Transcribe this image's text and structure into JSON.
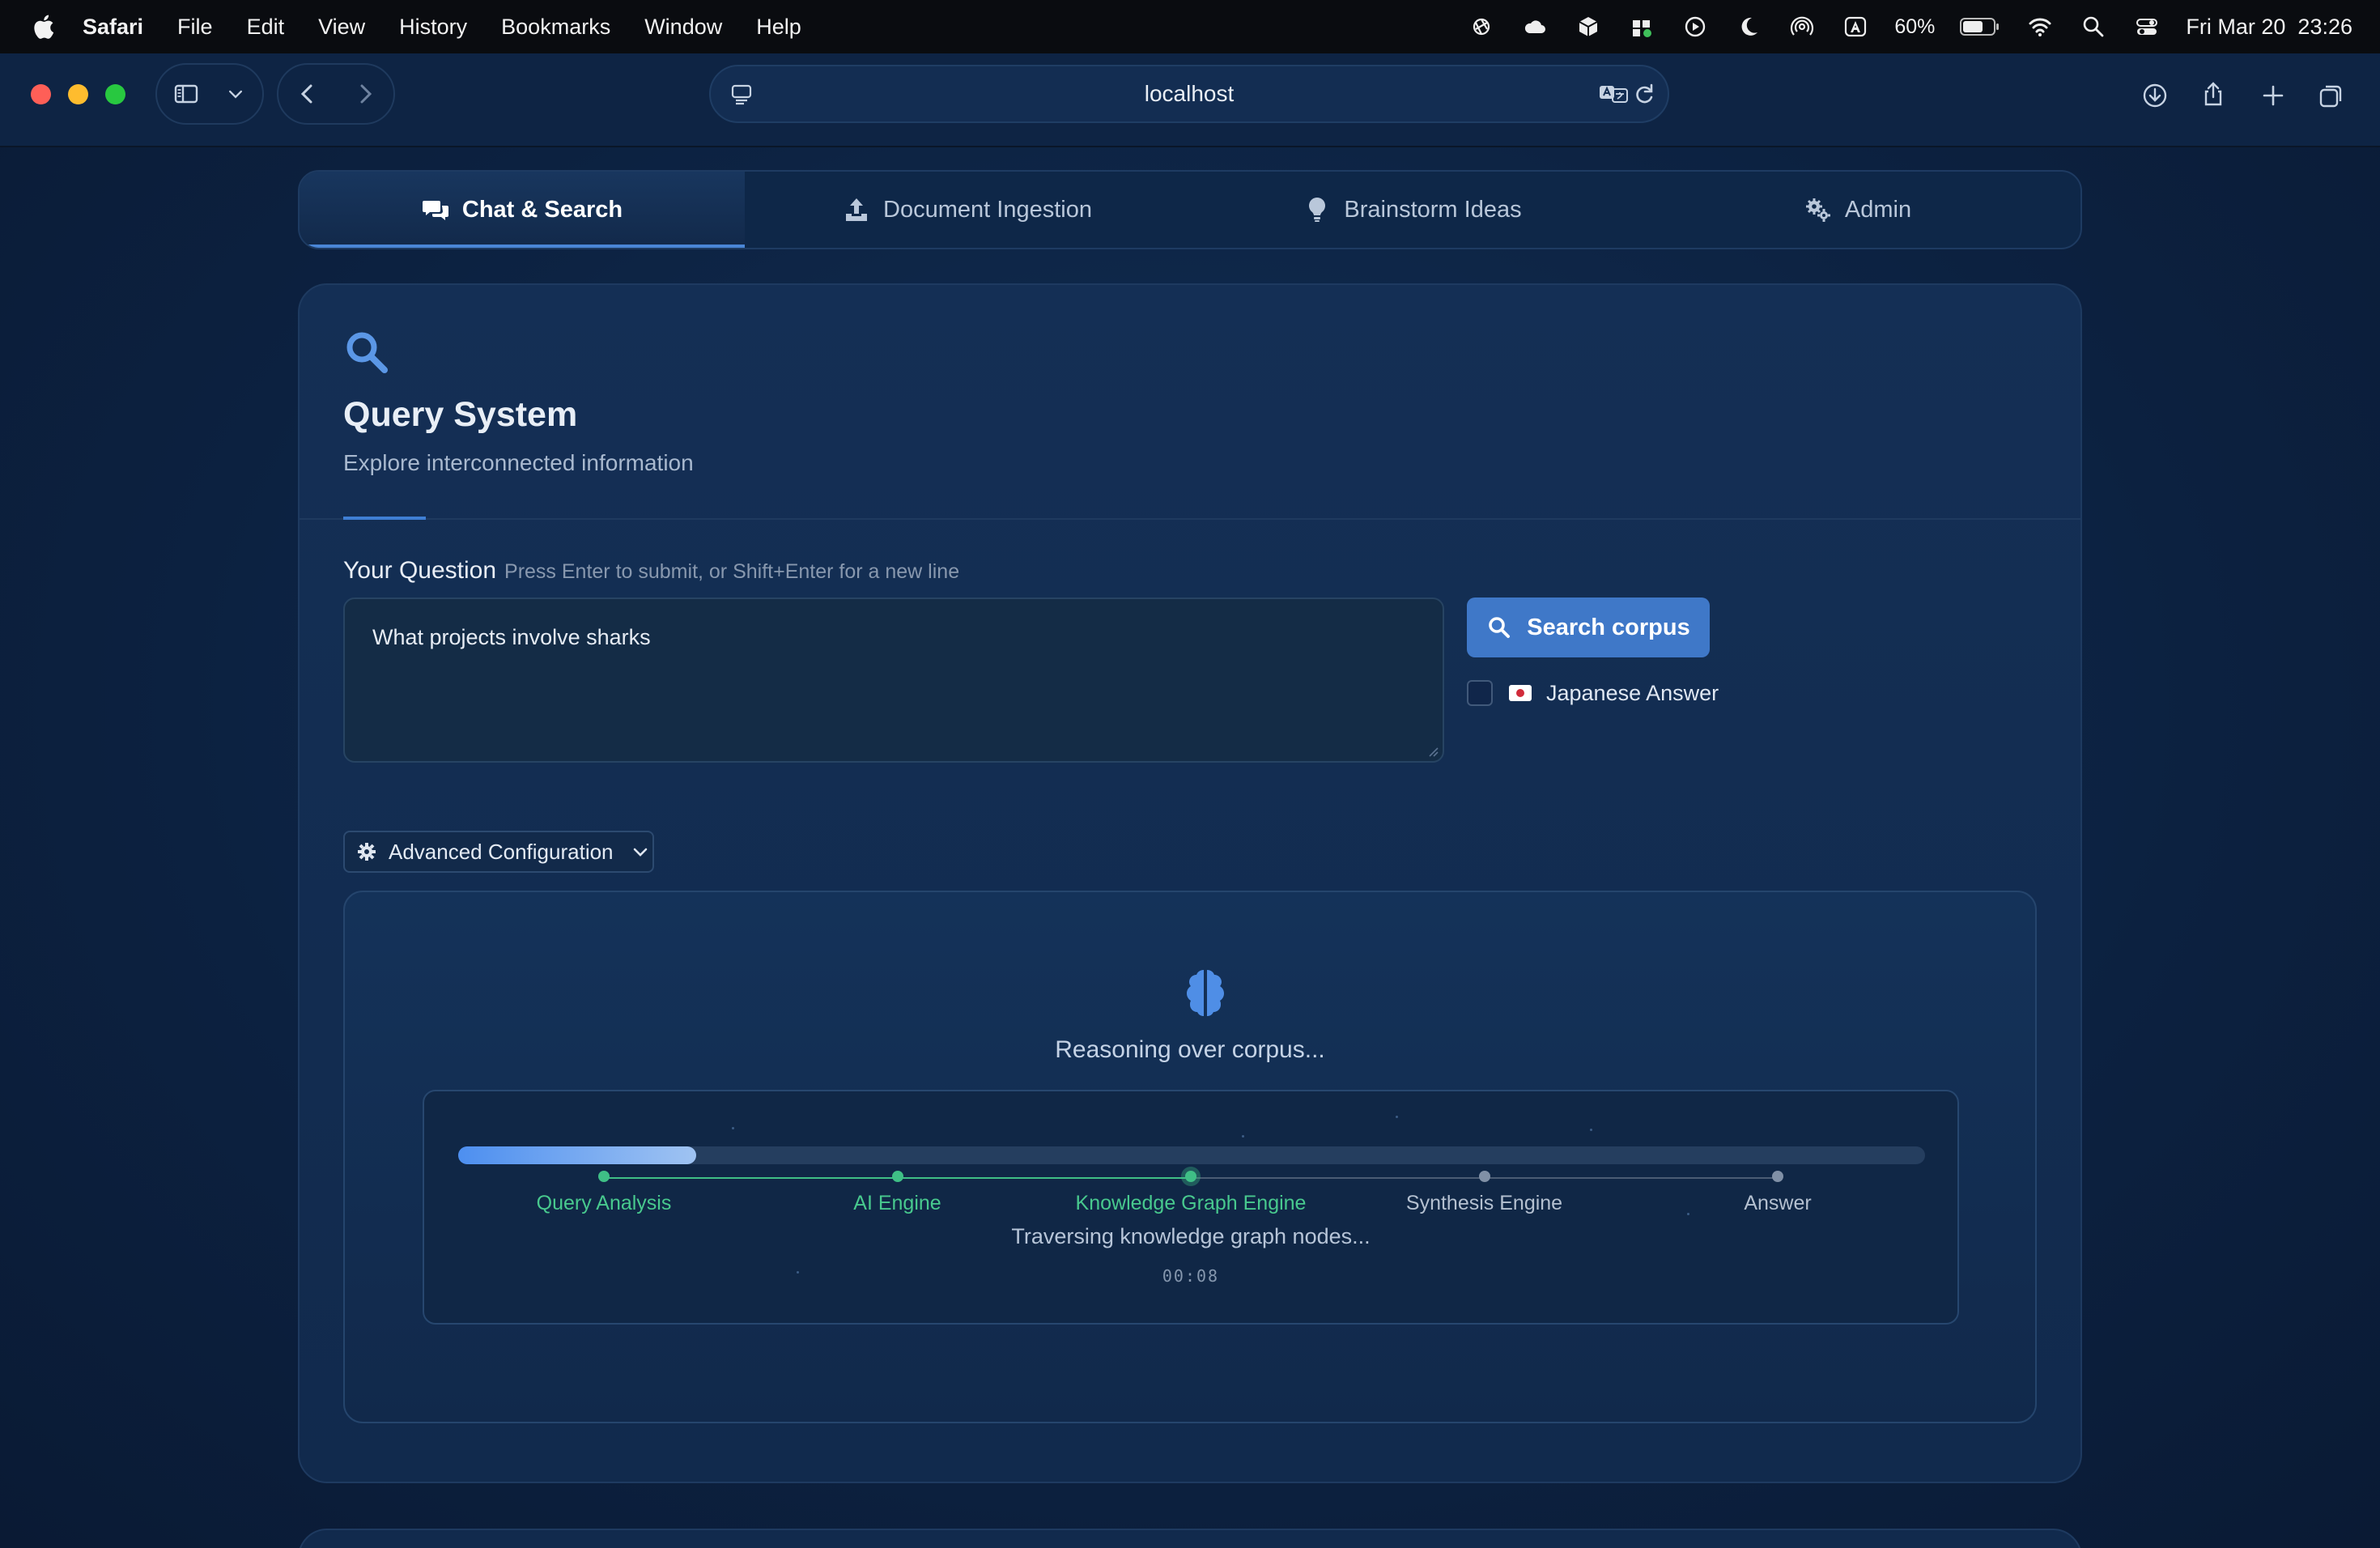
{
  "menubar": {
    "app": "Safari",
    "items": [
      "File",
      "Edit",
      "View",
      "History",
      "Bookmarks",
      "Window",
      "Help"
    ],
    "battery": "60%",
    "clock": "Fri Mar 20  23:26",
    "status_icons": [
      "openai-icon",
      "cloud-icon",
      "box-icon",
      "gift-icon",
      "play-icon",
      "moon-icon",
      "airdrop-icon",
      "keyboard-a-icon"
    ]
  },
  "browser": {
    "url": "localhost"
  },
  "tabs": [
    {
      "label": "Chat & Search",
      "icon": "comments-icon",
      "active": true
    },
    {
      "label": "Document Ingestion",
      "icon": "upload-icon",
      "active": false
    },
    {
      "label": "Brainstorm Ideas",
      "icon": "lightbulb-icon",
      "active": false
    },
    {
      "label": "Admin",
      "icon": "cogs-icon",
      "active": false
    }
  ],
  "query": {
    "title": "Query System",
    "subtitle": "Explore interconnected information",
    "label": "Your Question",
    "hint": "Press Enter to submit, or Shift+Enter for a new line",
    "question": "What projects involve sharks",
    "search_button": "Search corpus",
    "japanese_label": "Japanese Answer",
    "japanese_checked": false,
    "advanced": "Advanced Configuration"
  },
  "progress": {
    "heading": "Reasoning over corpus...",
    "fraction": 0.162,
    "stages": [
      {
        "name": "Query Analysis",
        "state": "done"
      },
      {
        "name": "AI Engine",
        "state": "done"
      },
      {
        "name": "Knowledge Graph Engine",
        "state": "current"
      },
      {
        "name": "Synthesis Engine",
        "state": "pending"
      },
      {
        "name": "Answer",
        "state": "pending"
      }
    ],
    "status": "Traversing knowledge graph nodes...",
    "elapsed": "00:08"
  },
  "colors": {
    "accent": "#3f78c8",
    "success": "#3fbf86",
    "background": "#0c2140"
  }
}
